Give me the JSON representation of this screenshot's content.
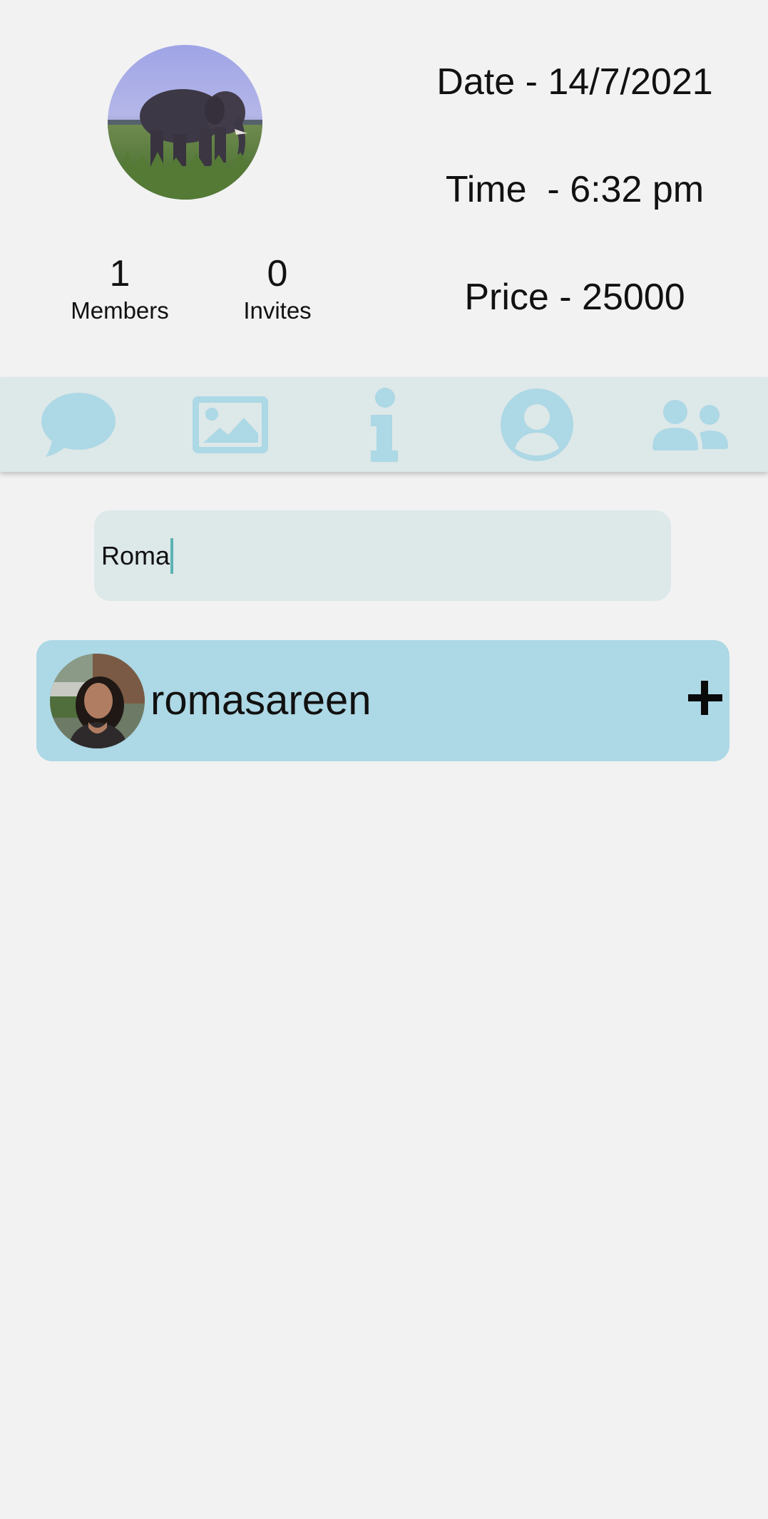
{
  "header": {
    "members": {
      "count": "1",
      "label": "Members"
    },
    "invites": {
      "count": "0",
      "label": "Invites"
    },
    "date": "Date - 14/7/2021",
    "time": "Time  - 6:32 pm",
    "price": "Price - 25000"
  },
  "tabs": [
    {
      "icon": "chat-bubble-icon"
    },
    {
      "icon": "image-icon"
    },
    {
      "icon": "info-icon"
    },
    {
      "icon": "user-circle-icon"
    },
    {
      "icon": "users-icon"
    }
  ],
  "search": {
    "value": "Roma"
  },
  "results": [
    {
      "username": "romasareen",
      "action_icon": "plus-icon"
    }
  ],
  "colors": {
    "background": "#f2f2f2",
    "tabbar": "#dde8e9",
    "icon": "#add8e5",
    "card": "#add8e5",
    "caret": "#5bb3b3"
  }
}
